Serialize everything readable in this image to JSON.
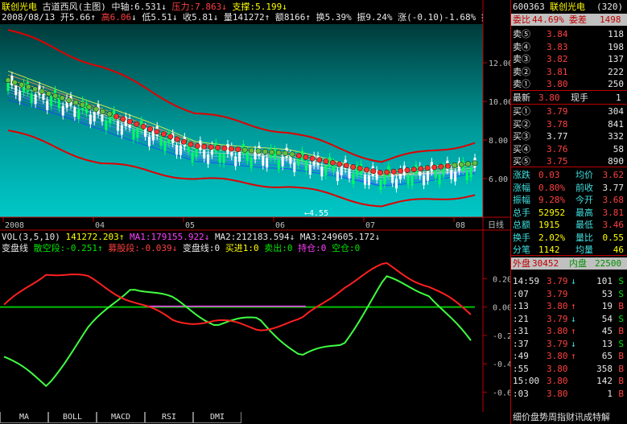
{
  "header": {
    "stock_name": "联创光电",
    "formula": "古道西风(主图)",
    "zhongzhou_label": "中轴:",
    "zhongzhou": "6.531",
    "yali_label": "压力:",
    "yali": "7.863",
    "zhicheng_label": "支撑:",
    "zhicheng": "5.199",
    "date": "2008/08/13",
    "open_label": "开",
    "open": "5.66",
    "high_label": "高",
    "high": "6.06",
    "low_label": "低",
    "low": "5.51",
    "close_label": "收",
    "close": "5.81",
    "vol_label": "量",
    "vol": "141272",
    "amt_label": "额",
    "amt": "8166",
    "turn_label": "换",
    "turn": "5.39%",
    "amp_label": "振",
    "amp": "9.24%",
    "chg_label": "涨",
    "chg": "(-0.10)-1.68%",
    "idx_label": "指数"
  },
  "price_axis": [
    "12.00",
    "10.00",
    "8.00",
    "6.00"
  ],
  "date_axis": [
    "2008",
    "04",
    "05",
    "06",
    "07",
    "08"
  ],
  "date_axis_end": "日线",
  "low_marker": "4.55",
  "vol_line": {
    "label": "VOL(3,5,10)",
    "vol": "141272.203",
    "ma1": "MA1:179155.922",
    "ma2": "MA2:212183.594",
    "ma3": "MA3:249605.172"
  },
  "indicator": {
    "name": "变盘线",
    "sanfang": "散空段:-0.251",
    "hunong": "募股段:-0.039",
    "bianpan": "变盘线:0",
    "mairu": "买进1:0",
    "maichu": "卖出:0",
    "chicang": "持仓:0",
    "kongcang": "空仓:0"
  },
  "ind_axis": [
    "0.20",
    "0.00",
    "-0.20",
    "-0.40",
    "-0.60"
  ],
  "tabs": [
    "MA",
    "BOLL",
    "MACD",
    "RSI",
    "DMI"
  ],
  "chart_data": [
    {
      "type": "line",
      "title": "",
      "x": [
        "2008",
        "04",
        "05",
        "06",
        "07",
        "08"
      ],
      "ylim": [
        4.0,
        14.0
      ],
      "series": [
        {
          "name": "压力",
          "values": [
            13.7,
            11.8,
            9.4,
            8.4,
            6.9,
            7.9
          ]
        },
        {
          "name": "中轴",
          "values": [
            10.8,
            9.2,
            7.4,
            7.0,
            6.0,
            6.5
          ]
        },
        {
          "name": "支撑",
          "values": [
            8.5,
            6.8,
            6.0,
            5.6,
            4.6,
            5.2
          ]
        }
      ]
    },
    {
      "type": "line",
      "title": "",
      "ylim": [
        -0.7,
        0.35
      ],
      "series": [
        {
          "name": "散空段",
          "values": [
            -0.35,
            -0.55,
            -0.15,
            0.15,
            0.05,
            -0.12,
            -0.08,
            -0.35,
            -0.25,
            0.2,
            0.1,
            -0.25
          ]
        },
        {
          "name": "募股段",
          "values": [
            0.0,
            0.25,
            0.2,
            0.05,
            -0.1,
            -0.1,
            -0.15,
            -0.1,
            0.15,
            0.3,
            0.15,
            -0.05
          ]
        }
      ]
    }
  ],
  "quote": {
    "code": "600363",
    "name": "联创光电",
    "count": "(320)",
    "weibi_label": "委比",
    "weibi": "44.69%",
    "weicha_label": "委差",
    "weicha": "1498",
    "sells": [
      {
        "label": "卖⑤",
        "price": "3.84",
        "vol": "118"
      },
      {
        "label": "卖④",
        "price": "3.83",
        "vol": "198"
      },
      {
        "label": "卖③",
        "price": "3.82",
        "vol": "137"
      },
      {
        "label": "卖②",
        "price": "3.81",
        "vol": "222"
      },
      {
        "label": "卖①",
        "price": "3.80",
        "vol": "250"
      }
    ],
    "last_label": "最新",
    "last": "3.80",
    "now_label": "现手",
    "now": "1",
    "buys": [
      {
        "label": "买①",
        "price": "3.79",
        "vol": "304"
      },
      {
        "label": "买②",
        "price": "3.78",
        "vol": "841"
      },
      {
        "label": "买③",
        "price": "3.77",
        "vol": "332"
      },
      {
        "label": "买④",
        "price": "3.76",
        "vol": "58"
      },
      {
        "label": "买⑤",
        "price": "3.75",
        "vol": "890"
      }
    ],
    "stats": [
      {
        "l1": "涨跌",
        "v1": "0.03",
        "l2": "均价",
        "v2": "3.62"
      },
      {
        "l1": "涨幅",
        "v1": "0.80%",
        "l2": "前收",
        "v2": "3.77"
      },
      {
        "l1": "振幅",
        "v1": "9.28%",
        "l2": "今开",
        "v2": "3.68"
      },
      {
        "l1": "总手",
        "v1": "52952",
        "l2": "最高",
        "v2": "3.81"
      },
      {
        "l1": "总额",
        "v1": "1915",
        "l2": "最低",
        "v2": "3.46"
      },
      {
        "l1": "换手",
        "v1": "2.02%",
        "l2": "量比",
        "v2": "0.55"
      },
      {
        "l1": "分笔",
        "v1": "1142",
        "l2": "均量",
        "v2": "46"
      }
    ],
    "waipan_label": "外盘",
    "waipan": "30452",
    "neipan_label": "内盘",
    "neipan": "22500",
    "ticks": [
      {
        "t": "14:59",
        "p": "3.79",
        "a": "↓",
        "v": "101",
        "s": "S"
      },
      {
        "t": ":07",
        "p": "3.79",
        "a": "",
        "v": "53",
        "s": "S"
      },
      {
        "t": ":13",
        "p": "3.80",
        "a": "↑",
        "v": "19",
        "s": "B"
      },
      {
        "t": ":21",
        "p": "3.79",
        "a": "↓",
        "v": "54",
        "s": "S"
      },
      {
        "t": ":31",
        "p": "3.80",
        "a": "↑",
        "v": "45",
        "s": "B"
      },
      {
        "t": ":37",
        "p": "3.79",
        "a": "↓",
        "v": "13",
        "s": "S"
      },
      {
        "t": ":49",
        "p": "3.80",
        "a": "↑",
        "v": "65",
        "s": "B"
      },
      {
        "t": ":55",
        "p": "3.80",
        "a": "",
        "v": "358",
        "s": "B"
      },
      {
        "t": "15:00",
        "p": "3.80",
        "a": "",
        "v": "142",
        "s": "B"
      },
      {
        "t": ":03",
        "p": "3.80",
        "a": "",
        "v": "1",
        "s": "B"
      }
    ],
    "bottom_bar": "细价盘势周指财讯成特解"
  },
  "colors": {
    "up": "#ff4040",
    "down": "#00e600",
    "frame": "#c00000",
    "axis": "#c0c0c0"
  }
}
